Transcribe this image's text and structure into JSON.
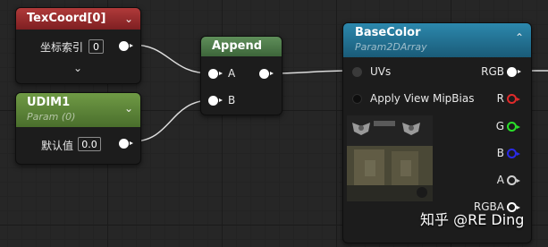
{
  "texcoord_node": {
    "title": "TexCoord[0]",
    "param_label": "坐标索引",
    "param_value": "0",
    "collapse_icon": "chevron-down-icon",
    "header_color": "#9b2b2b"
  },
  "udim_node": {
    "title": "UDIM1",
    "subtitle": "Param (0)",
    "param_label": "默认值",
    "param_value": "0.0",
    "collapse_icon": "chevron-down-icon",
    "header_color": "#5b7f3a"
  },
  "append_node": {
    "title": "Append",
    "input_a": "A",
    "input_b": "B",
    "header_color": "#4e7a4a"
  },
  "basecolor_node": {
    "title": "BaseColor",
    "subtitle": "Param2DArray",
    "collapse_icon": "chevron-up-icon",
    "header_color": "#1f6f8f",
    "inputs": [
      "UVs",
      "Apply View MipBias"
    ],
    "outputs": [
      "RGB",
      "R",
      "G",
      "B",
      "A",
      "RGBA"
    ],
    "output_colors": {
      "R": "#e02a2a",
      "G": "#2ae02a",
      "B": "#2a2ae8",
      "A": "#cfcfcf",
      "RGBA": "#ffffff"
    }
  },
  "watermark": "知乎 @RE Ding"
}
